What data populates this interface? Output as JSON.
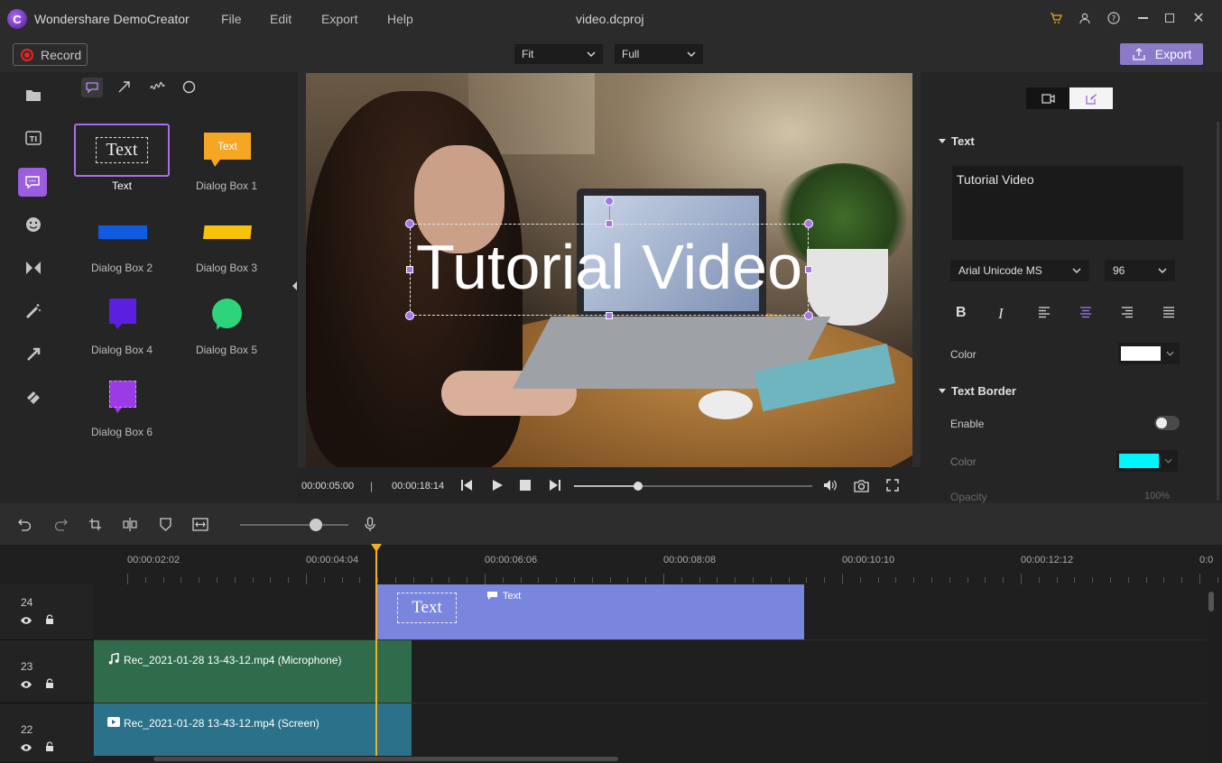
{
  "app": {
    "title": "Wondershare DemoCreator",
    "file_name": "video.dcproj"
  },
  "menu": [
    "File",
    "Edit",
    "Export",
    "Help"
  ],
  "toolbar": {
    "record_label": "Record",
    "fit_value": "Fit",
    "full_value": "Full",
    "export_label": "Export"
  },
  "library": {
    "items": [
      {
        "label": "Text",
        "thumb": "Text",
        "color": "#ffffff"
      },
      {
        "label": "Dialog Box 1",
        "thumb": "Text",
        "color": "#f5a623"
      },
      {
        "label": "Dialog Box 2",
        "thumb": "",
        "color": "#0f5ce0"
      },
      {
        "label": "Dialog Box 3",
        "thumb": "",
        "color": "#f9c20a"
      },
      {
        "label": "Dialog Box 4",
        "thumb": "",
        "color": "#5b1fe0"
      },
      {
        "label": "Dialog Box 5",
        "thumb": "",
        "color": "#2ed47a"
      },
      {
        "label": "Dialog Box 6",
        "thumb": "",
        "color": "#9a3be6"
      }
    ]
  },
  "preview": {
    "overlay_text": "Tutorial Video",
    "current_time": "00:00:05:00",
    "separator": "|",
    "total_time": "00:00:18:14",
    "progress": 0.27
  },
  "props": {
    "text_section": "Text",
    "text_value": "Tutorial Video",
    "font": "Arial Unicode MS",
    "size": "96",
    "color_label": "Color",
    "text_color": "#ffffff",
    "border_section": "Text Border",
    "enable_label": "Enable",
    "border_color_label": "Color",
    "border_color": "#00f5ff",
    "opacity_label": "Opacity",
    "opacity_value": "100%"
  },
  "timeline": {
    "zoom": 0.7,
    "ruler": [
      "00:00:02:02",
      "00:00:04:04",
      "00:00:06:06",
      "00:00:08:08",
      "00:00:10:10",
      "00:00:12:12",
      "0:0"
    ],
    "tracks": [
      {
        "number": "24",
        "clip_label": "Text",
        "thumb": "Text"
      },
      {
        "number": "23",
        "clip_label": "Rec_2021-01-28 13-43-12.mp4 (Microphone)"
      },
      {
        "number": "22",
        "clip_label": "Rec_2021-01-28 13-43-12.mp4 (Screen)"
      }
    ]
  }
}
